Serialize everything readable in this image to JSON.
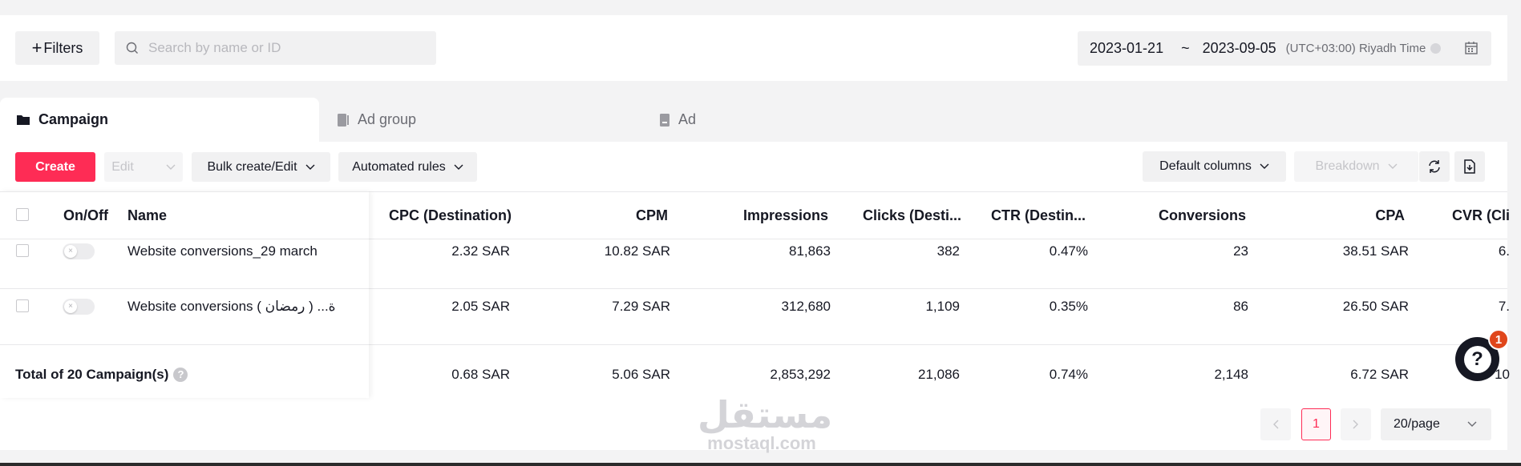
{
  "toolbar": {
    "filters_label": "Filters",
    "search_placeholder": "Search by name or ID",
    "date_start": "2023-01-21",
    "date_separator": "~",
    "date_end": "2023-09-05",
    "timezone": "(UTC+03:00) Riyadh Time"
  },
  "tabs": [
    {
      "label": "Campaign",
      "active": true,
      "icon": "folder-icon"
    },
    {
      "label": "Ad group",
      "active": false,
      "icon": "adgroup-icon"
    },
    {
      "label": "Ad",
      "active": false,
      "icon": "ad-icon"
    }
  ],
  "actions": {
    "create": "Create",
    "edit": "Edit",
    "bulk": "Bulk create/Edit",
    "automated": "Automated rules",
    "default_columns": "Default columns",
    "breakdown": "Breakdown"
  },
  "table": {
    "columns": [
      "On/Off",
      "Name",
      "CPC (Destination)",
      "CPM",
      "Impressions",
      "Clicks (Desti...",
      "CTR (Destin...",
      "Conversions",
      "CPA",
      "CVR (Cli"
    ],
    "rows": [
      {
        "name": "Website conversions_29 march",
        "cpc": "2.32 SAR",
        "cpm": "10.82 SAR",
        "impressions": "81,863",
        "clicks": "382",
        "ctr": "0.47%",
        "conversions": "23",
        "cpa": "38.51 SAR",
        "cvr": "6."
      },
      {
        "name": "Website conversions ( رمضان ) ...ة",
        "cpc": "2.05 SAR",
        "cpm": "7.29 SAR",
        "impressions": "312,680",
        "clicks": "1,109",
        "ctr": "0.35%",
        "conversions": "86",
        "cpa": "26.50 SAR",
        "cvr": "7."
      }
    ],
    "total": {
      "label": "Total of 20 Campaign(s)",
      "cpc": "0.68 SAR",
      "cpm": "5.06 SAR",
      "impressions": "2,853,292",
      "clicks": "21,086",
      "ctr": "0.74%",
      "conversions": "2,148",
      "cpa": "6.72 SAR",
      "cvr": "10"
    }
  },
  "pagination": {
    "current": "1",
    "page_size": "20/page"
  },
  "help_badge": "1",
  "help_symbol": "?",
  "watermark": {
    "arabic": "مستقل",
    "latin": "mostaql.com"
  },
  "colors": {
    "accent": "#fe2c55",
    "badge": "#e0461b"
  }
}
